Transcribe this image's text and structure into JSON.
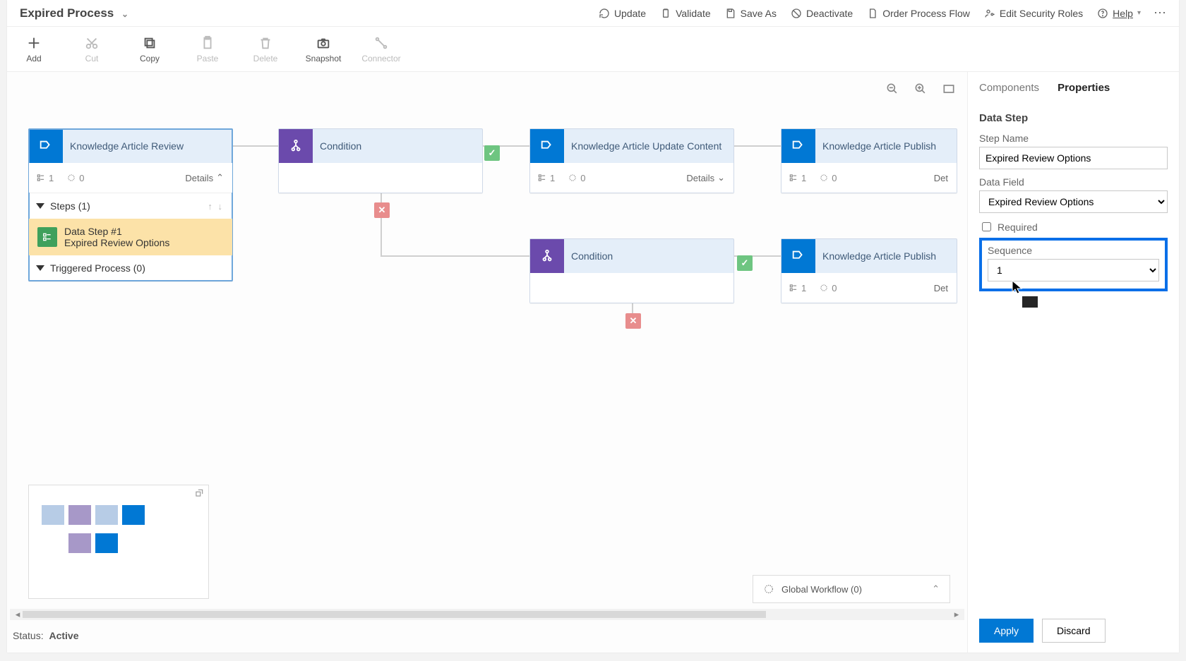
{
  "header": {
    "title": "Expired Process",
    "actions": {
      "update": "Update",
      "validate": "Validate",
      "save_as": "Save As",
      "deactivate": "Deactivate",
      "order": "Order Process Flow",
      "security": "Edit Security Roles",
      "help": "Help"
    }
  },
  "ribbon": {
    "add": "Add",
    "cut": "Cut",
    "copy": "Copy",
    "paste": "Paste",
    "delete": "Delete",
    "snapshot": "Snapshot",
    "connector": "Connector"
  },
  "sidebar": {
    "tab_components": "Components",
    "tab_properties": "Properties",
    "section": "Data Step",
    "step_name_label": "Step Name",
    "step_name_value": "Expired Review Options",
    "data_field_label": "Data Field",
    "data_field_value": "Expired Review Options",
    "required_label": "Required",
    "sequence_label": "Sequence",
    "sequence_value": "1",
    "apply": "Apply",
    "discard": "Discard"
  },
  "nodes": {
    "n1": {
      "title": "Knowledge Article Review",
      "steps": "1",
      "loops": "0",
      "details": "Details"
    },
    "n1_expand": {
      "steps_header": "Steps (1)",
      "data_step_line1": "Data Step #1",
      "data_step_line2": "Expired Review Options",
      "triggered": "Triggered Process (0)"
    },
    "c1": {
      "title": "Condition"
    },
    "n2": {
      "title": "Knowledge Article Update Content",
      "steps": "1",
      "loops": "0",
      "details": "Details"
    },
    "n3": {
      "title": "Knowledge Article Publish",
      "steps": "1",
      "loops": "0",
      "details": "Det"
    },
    "c2": {
      "title": "Condition"
    },
    "n4": {
      "title": "Knowledge Article Publish",
      "steps": "1",
      "loops": "0",
      "details": "Det"
    }
  },
  "global_workflow": "Global Workflow (0)",
  "status_label": "Status:",
  "status_value": "Active"
}
